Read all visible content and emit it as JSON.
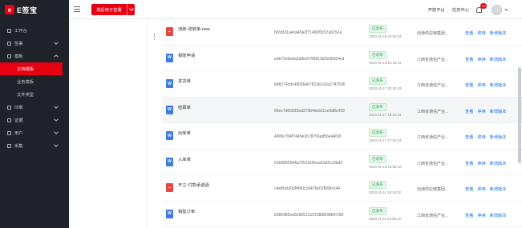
{
  "app": {
    "logo_mark": "e",
    "logo_text": "E签宝"
  },
  "sidebar": {
    "items": [
      {
        "label": "工作台",
        "icon": "home-icon",
        "chevron": ""
      },
      {
        "label": "签署",
        "icon": "pen-icon",
        "chevron": "down"
      },
      {
        "label": "模板",
        "icon": "template-icon",
        "chevron": "up"
      }
    ],
    "sub_items": [
      {
        "label": "文档模板",
        "active": true
      },
      {
        "label": "业务模板",
        "active": false
      },
      {
        "label": "文件类型",
        "active": false
      }
    ],
    "items_after": [
      {
        "label": "印章",
        "icon": "seal-icon"
      },
      {
        "label": "证据",
        "icon": "evidence-icon"
      },
      {
        "label": "用户",
        "icon": "user-icon"
      },
      {
        "label": "采集",
        "icon": "collect-icon"
      }
    ]
  },
  "topbar": {
    "sign_button": "发起电子签署",
    "links": [
      "开放平台",
      "任务中心"
    ],
    "notification_count": "29"
  },
  "rows": [
    {
      "type": "pdf",
      "name": "流转-流转单-new",
      "hash": "bf2d321a4ca45a2f71493f3c97a6152a",
      "status": "已发布",
      "time": "2023-11-28 22:06:53",
      "company": "创通供应链集团...",
      "actions": [
        "查看",
        "停用",
        "新增版本"
      ]
    },
    {
      "type": "word",
      "name": "报账申请",
      "hash": "eeb72ebeba2dfee5795813d1b35d24cd",
      "status": "已发布",
      "time": "2023-11-19 10:34:41",
      "company": "江西省通信产业...",
      "actions": [
        "查看",
        "停用",
        "新增版本"
      ]
    },
    {
      "type": "word",
      "name": "发货单",
      "hash": "bb8274cdc49636a67813e216a2747536",
      "status": "已发布",
      "time": "2023-11-17 20:20:43",
      "company": "江西省通信产业...",
      "actions": [
        "查看",
        "停用",
        "新增版本"
      ]
    },
    {
      "type": "word",
      "name": "结算单",
      "hash": "65ec7d65833ad279b4deb11ce6d8c439",
      "status": "已发布",
      "time": "2023-11-17 18:54:34",
      "company": "江西省通信产业...",
      "actions": [
        "查看",
        "停用",
        "新增版本"
      ]
    },
    {
      "type": "word",
      "name": "出库单",
      "hash": "4909c7b4f7445e2b78756ad56e44f18",
      "status": "已发布",
      "time": "2023-11-17 17:52:23",
      "company": "江西省通信产业...",
      "actions": [
        "查看",
        "停用",
        "新增版本"
      ]
    },
    {
      "type": "word",
      "name": "入库单",
      "hash": "01b0850564a72519c8cea91d3cc9bd2",
      "status": "已发布",
      "time": "2023-11-16 16:58:42",
      "company": "江西省通信产业...",
      "actions": [
        "查看",
        "停用",
        "新增版本"
      ]
    },
    {
      "type": "pdf",
      "name": "开立-付款承诺函",
      "hash": "c4e80cb2d3f490c1d476e02f699cc44",
      "status": "已发布",
      "time": "2023-11-11 16:19:32",
      "company": "创通供应链集团...",
      "actions": [
        "查看",
        "停用",
        "新增版本"
      ]
    },
    {
      "type": "word",
      "name": "销售订单",
      "hash": "b28e985ea5e5651315108d839df0736f",
      "status": "已发布",
      "time": "2023-11-11 15:55:32",
      "company": "江西省通信产业...",
      "actions": [
        "查看",
        "停用",
        "新增版本"
      ]
    }
  ],
  "colors": {
    "brand": "#e60012",
    "sidebar_bg": "#1f2229",
    "link": "#1a6fe8",
    "status_green": "#2ea44f"
  }
}
